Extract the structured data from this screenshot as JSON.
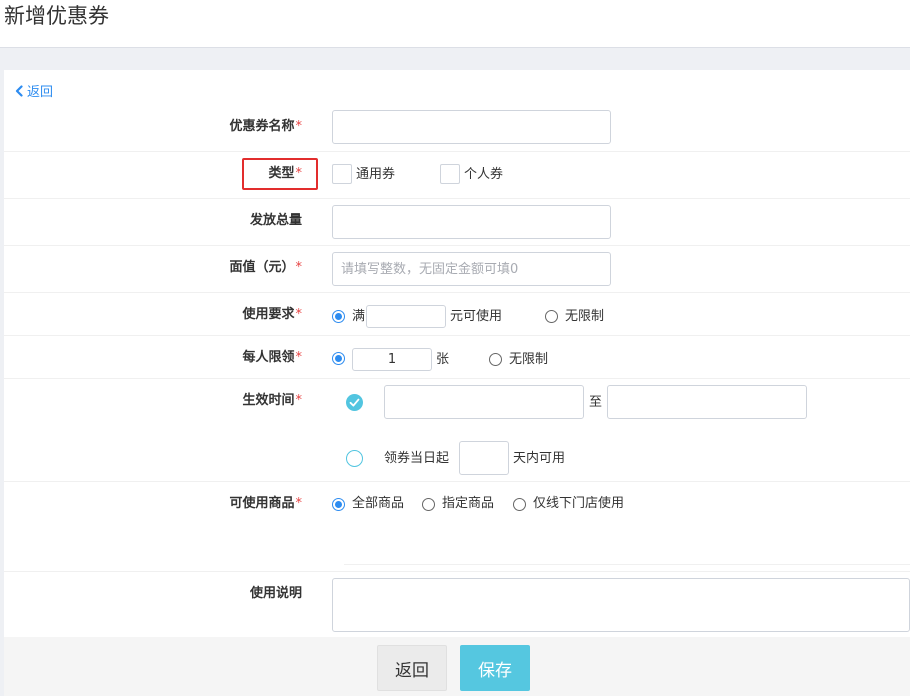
{
  "page": {
    "title": "新增优惠券"
  },
  "back_link": {
    "label": "返回"
  },
  "form": {
    "name": {
      "label": "优惠券名称",
      "required": "*",
      "value": ""
    },
    "type": {
      "label": "类型",
      "required": "*",
      "options": [
        "通用券",
        "个人券"
      ]
    },
    "total": {
      "label": "发放总量",
      "value": ""
    },
    "face_value": {
      "label": "面值（元）",
      "required": "*",
      "placeholder": "请填写整数，无固定金额可填0"
    },
    "usage": {
      "label": "使用要求",
      "required": "*",
      "prefix": "满",
      "amount": "",
      "suffix": "元可使用",
      "unlimited": "无限制"
    },
    "per_person": {
      "label": "每人限领",
      "required": "*",
      "value": "1",
      "unit": "张",
      "unlimited": "无限制"
    },
    "valid_time": {
      "label": "生效时间",
      "required": "*",
      "start": "",
      "separator": "至",
      "end": "",
      "relative_prefix": "领券当日起",
      "relative_days": "",
      "relative_suffix": "天内可用"
    },
    "goods": {
      "label": "可使用商品",
      "required": "*",
      "options": [
        "全部商品",
        "指定商品",
        "仅线下门店使用"
      ]
    },
    "description": {
      "label": "使用说明",
      "value": ""
    }
  },
  "footer": {
    "back_label": "返回",
    "save_label": "保存"
  },
  "colors": {
    "accent": "#2d8cf0",
    "save": "#55c7e0",
    "required": "#e64242",
    "highlight_box": "#e22d2d"
  }
}
